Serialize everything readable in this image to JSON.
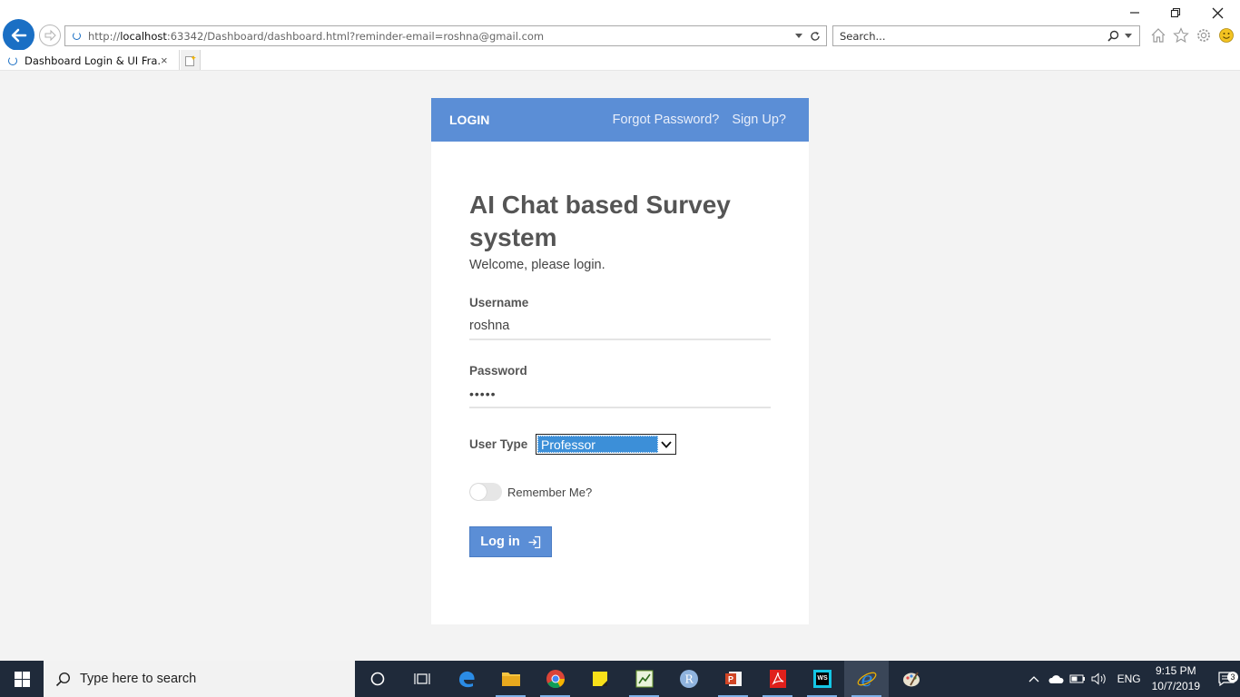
{
  "browser": {
    "url_prefix": "http://",
    "url_host": "localhost",
    "url_rest": ":63342/Dashboard/dashboard.html?reminder-email=roshna@gmail.com",
    "search_placeholder": "Search...",
    "tab_title": "Dashboard Login & UI Fra...",
    "tab_close": "×"
  },
  "header": {
    "login_tab": "LOGIN",
    "forgot_link": "Forgot Password?",
    "signup_link": "Sign Up?"
  },
  "form": {
    "title": "AI Chat based Survey system",
    "welcome": "Welcome, please login.",
    "username_label": "Username",
    "username_value": "roshna",
    "password_label": "Password",
    "password_value": "•••••",
    "usertype_label": "User Type",
    "usertype_selected": "Professor",
    "remember_label": "Remember Me?",
    "remember_checked": false,
    "login_button": "Log in"
  },
  "taskbar": {
    "search_placeholder": "Type here to search",
    "apps": [
      "cortana-icon",
      "task-view-icon",
      "edge-icon",
      "file-explorer-icon",
      "chrome-icon",
      "sticky-notes-icon",
      "spreadsheet-icon",
      "r-icon",
      "powerpoint-icon",
      "acrobat-icon",
      "webstorm-icon",
      "internet-explorer-icon",
      "paint-icon"
    ],
    "language": "ENG",
    "time": "9:15 PM",
    "date": "10/7/2019",
    "notification_count": "3"
  },
  "colors": {
    "accent": "#5b8ed6",
    "taskbar_bg": "#1f2a3a",
    "ie_blue": "#1a6fc4"
  }
}
